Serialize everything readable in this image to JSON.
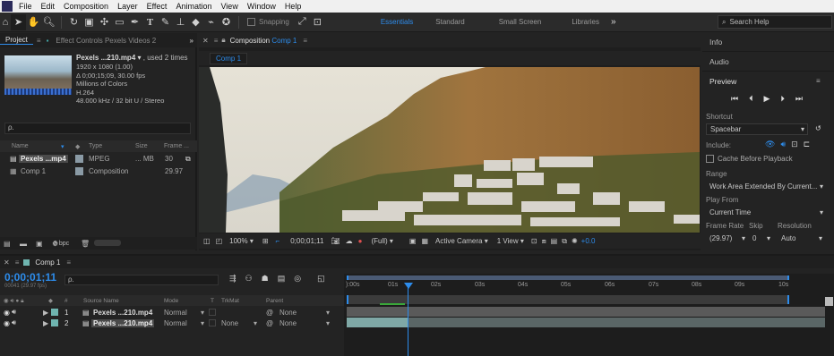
{
  "menu": [
    "File",
    "Edit",
    "Composition",
    "Layer",
    "Effect",
    "Animation",
    "View",
    "Window",
    "Help"
  ],
  "toolbar": {
    "snapping_label": "Snapping",
    "workspaces": [
      "Essentials",
      "Standard",
      "Small Screen",
      "Libraries"
    ],
    "more": "»",
    "search_placeholder": "Search Help"
  },
  "project": {
    "tab_label": "Project",
    "effect_controls_tab": "Effect Controls Pexels Videos 2",
    "more": "»",
    "file_name": "Pexels ...210.mp4",
    "used": ", used 2 times",
    "info_lines": [
      "1920 x 1080 (1.00)",
      "Δ 0;00;15;09, 30.00 fps",
      "Millions of Colors",
      "H.264",
      "48.000 kHz / 32 bit U / Stereo"
    ],
    "search_placeholder": "ρ.",
    "columns": [
      "Name",
      "Type",
      "Size",
      "Frame ..."
    ],
    "items": [
      {
        "name": "Pexels ...mp4",
        "type": "MPEG",
        "size": "... MB",
        "fps": "30"
      },
      {
        "name": "Comp 1",
        "type": "Composition",
        "size": "",
        "fps": "29.97"
      }
    ],
    "bpc": "8 bpc"
  },
  "composition": {
    "tab_prefix": "Composition",
    "tab_name": "Comp 1",
    "subtab": "Comp 1",
    "zoom": "100%",
    "timecode": "0;00;01;11",
    "quality": "(Full)",
    "camera": "Active Camera",
    "view": "1 View",
    "exposure": "+0.0"
  },
  "side": {
    "info": "Info",
    "audio": "Audio",
    "preview": "Preview",
    "shortcut_label": "Shortcut",
    "shortcut_value": "Spacebar",
    "include_label": "Include:",
    "cache_label": "Cache Before Playback",
    "range_label": "Range",
    "range_value": "Work Area Extended By Current...",
    "playfrom_label": "Play From",
    "playfrom_value": "Current Time",
    "framerate_label": "Frame Rate",
    "skip_label": "Skip",
    "resolution_label": "Resolution",
    "framerate_value": "(29.97)",
    "skip_value": "0",
    "resolution_value": "Auto"
  },
  "timeline": {
    "tab": "Comp 1",
    "timecode": "0;00;01;11",
    "fps_sub": "00041 (29.97 fps)",
    "search_placeholder": "ρ.",
    "columns": [
      "#",
      "Source Name",
      "Mode",
      "T",
      "TrkMat",
      "Parent"
    ],
    "ruler": [
      "):00s",
      "01s",
      "02s",
      "03s",
      "04s",
      "05s",
      "06s",
      "07s",
      "08s",
      "09s",
      "10s"
    ],
    "layers": [
      {
        "num": "1",
        "name": "Pexels ...210.mp4",
        "mode": "Normal",
        "trkmat": "",
        "parent": "None"
      },
      {
        "num": "2",
        "name": "Pexels ...210.mp4",
        "mode": "Normal",
        "trkmat": "None",
        "parent": "None"
      }
    ]
  },
  "colors": {
    "accent": "#2d8ceb",
    "label_teal": "#6fb5b0",
    "label_gray": "#8a9aa5"
  }
}
